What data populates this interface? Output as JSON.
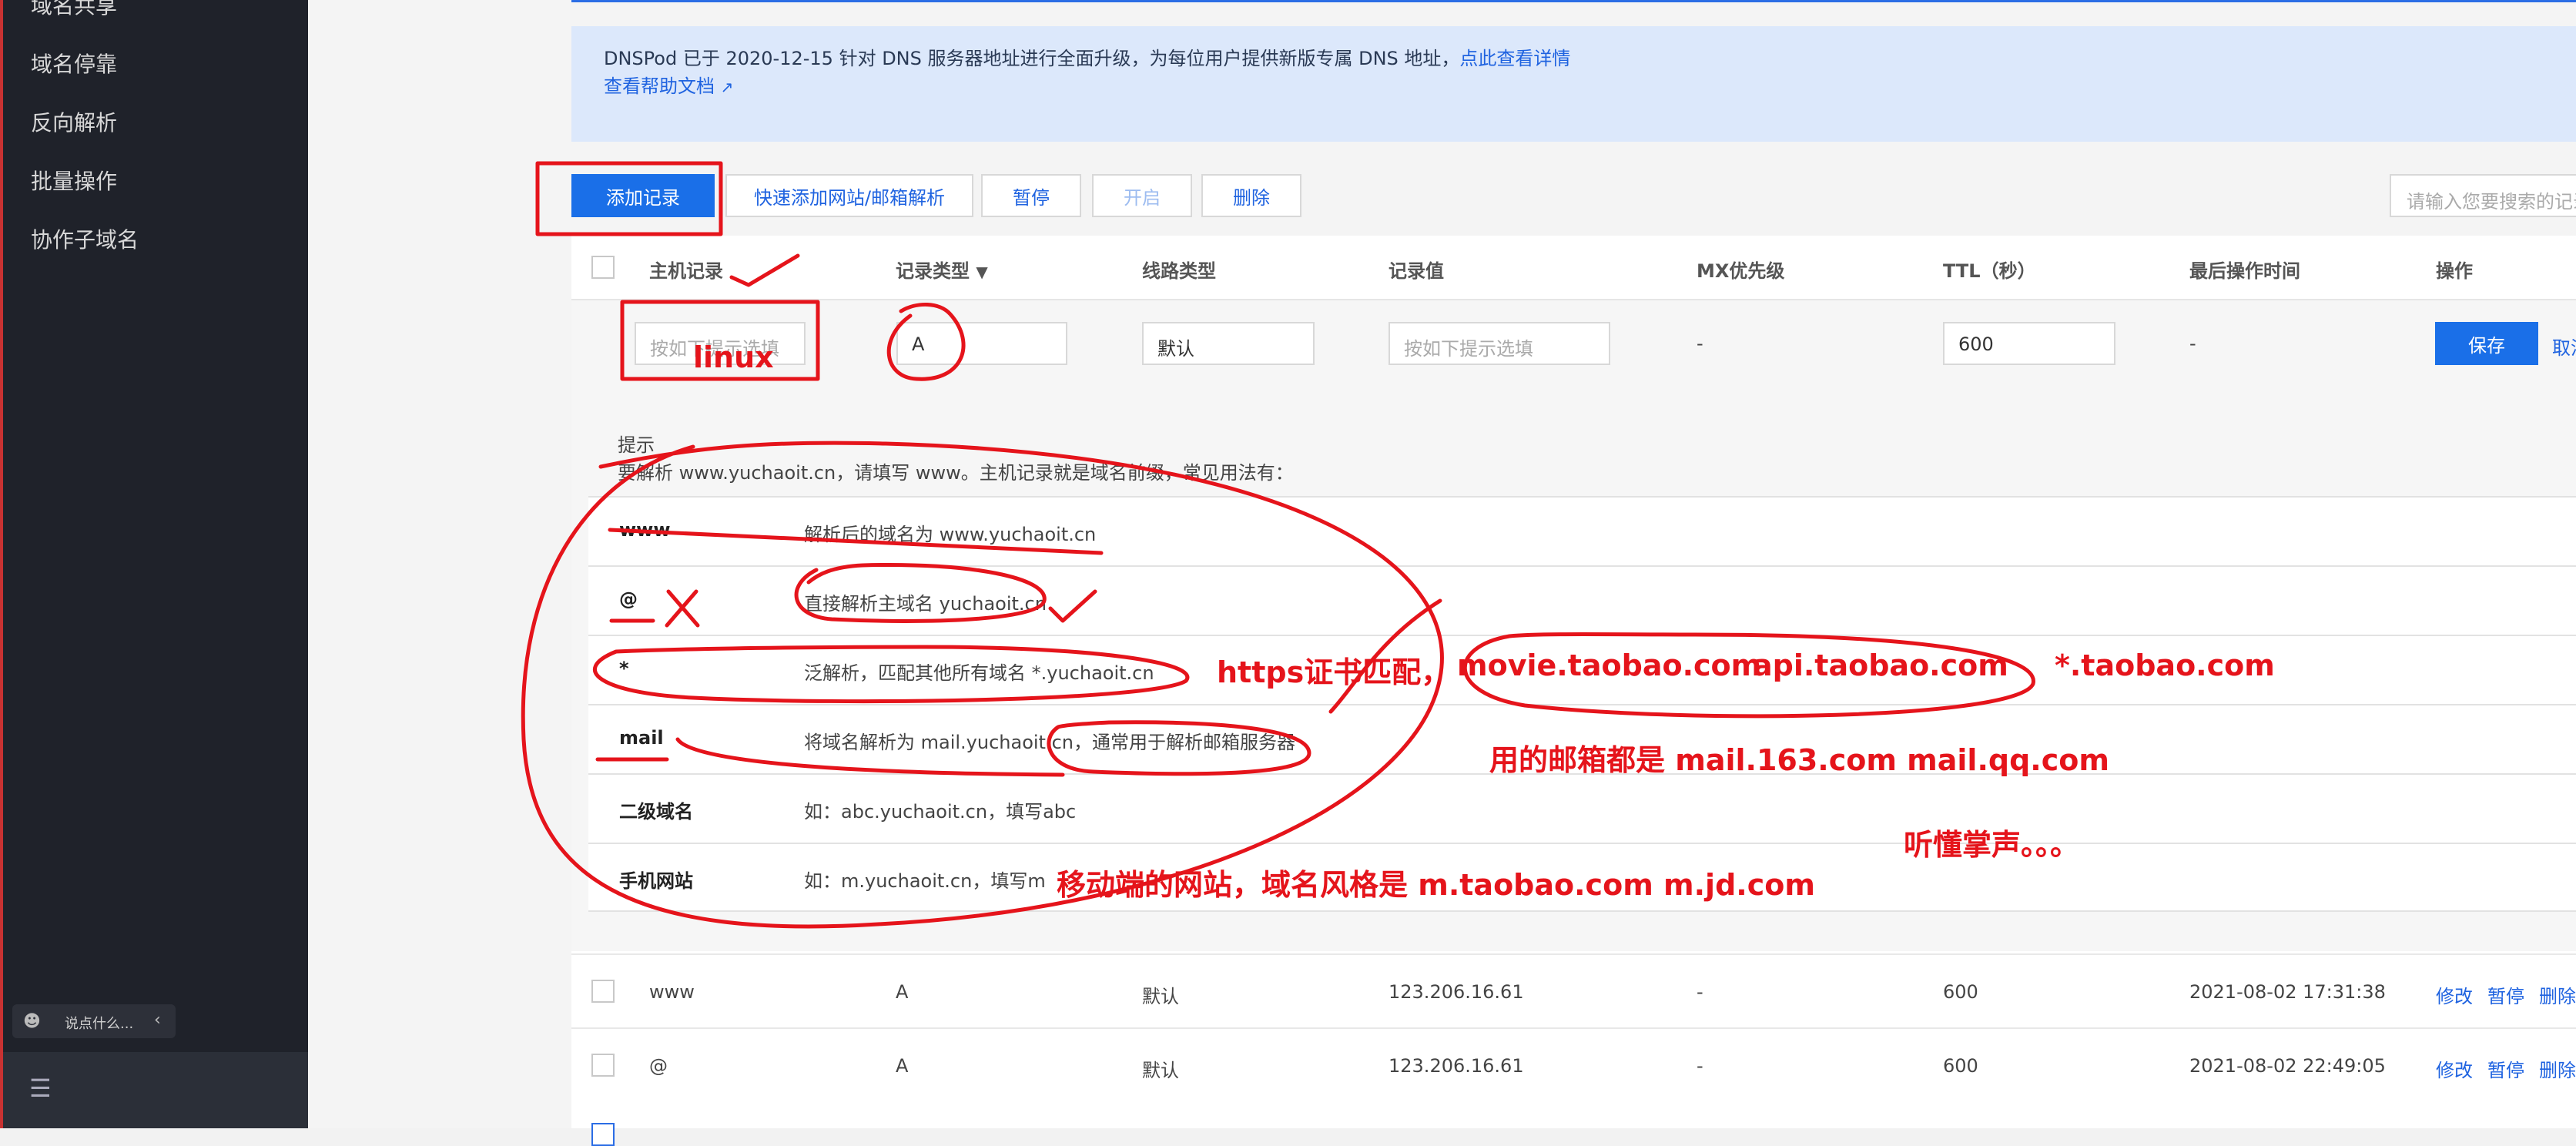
{
  "sidebar": {
    "items": [
      "域名共享",
      "域名停靠",
      "反向解析",
      "批量操作",
      "协作子域名"
    ],
    "chat_placeholder": "说点什么..."
  },
  "notice": {
    "line1": "DNSPod 已于 2020-12-15 针对 DNS 服务器地址进行全面升级，为每位用户提供新版专属 DNS 地址，",
    "link1": "点此查看详情",
    "link2": "查看帮助文档"
  },
  "toolbar": {
    "add_record": "添加记录",
    "quick_add": "快速添加网站/邮箱解析",
    "pause": "暂停",
    "enable": "开启",
    "delete": "删除",
    "search_placeholder": "请输入您要搜索的记录"
  },
  "table": {
    "headers": [
      "主机记录",
      "记录类型",
      "线路类型",
      "记录值",
      "MX优先级",
      "TTL（秒）",
      "最后操作时间",
      "操作"
    ],
    "edit_row": {
      "host_placeholder": "按如下提示选填",
      "type": "A",
      "line": "默认",
      "value_placeholder": "按如下提示选填",
      "mx": "-",
      "ttl": "600",
      "time": "-",
      "save": "保存",
      "cancel": "取消"
    },
    "rows": [
      {
        "host": "www",
        "type": "A",
        "line": "默认",
        "value": "123.206.16.61",
        "mx": "-",
        "ttl": "600",
        "time": "2021-08-02 17:31:38",
        "op1": "修改",
        "op2": "暂停",
        "op3": "删除"
      },
      {
        "host": "@",
        "type": "A",
        "line": "默认",
        "value": "123.206.16.61",
        "mx": "-",
        "ttl": "600",
        "time": "2021-08-02 22:49:05",
        "op1": "修改",
        "op2": "暂停",
        "op3": "删除"
      }
    ]
  },
  "tips": {
    "title": "提示",
    "intro": "要解析 www.yuchaoit.cn，请填写 www。主机记录就是域名前缀，常见用法有：",
    "rows": [
      {
        "key": "www",
        "desc": "解析后的域名为 www.yuchaoit.cn"
      },
      {
        "key": "@",
        "desc": "直接解析主域名 yuchaoit.cn"
      },
      {
        "key": "*",
        "desc": "泛解析，匹配其他所有域名 *.yuchaoit.cn"
      },
      {
        "key": "mail",
        "desc": "将域名解析为 mail.yuchaoit.cn，通常用于解析邮箱服务器"
      },
      {
        "key": "二级域名",
        "desc": "如：abc.yuchaoit.cn，填写abc"
      },
      {
        "key": "手机网站",
        "desc": "如：m.yuchaoit.cn，填写m"
      }
    ]
  },
  "annotations": {
    "linux": "linux",
    "https": "https证书匹配，",
    "movie": "movie.taobao.com",
    "api": "api.taobao.com",
    "wild": "*.taobao.com",
    "mail_note": "用的邮箱都是  mail.163.com   mail.qq.com",
    "applause": "听懂掌声。。。",
    "mobile": "移动端的网站，域名风格是    m.taobao.com    m.jd.com",
    "color": "#e5141b"
  }
}
